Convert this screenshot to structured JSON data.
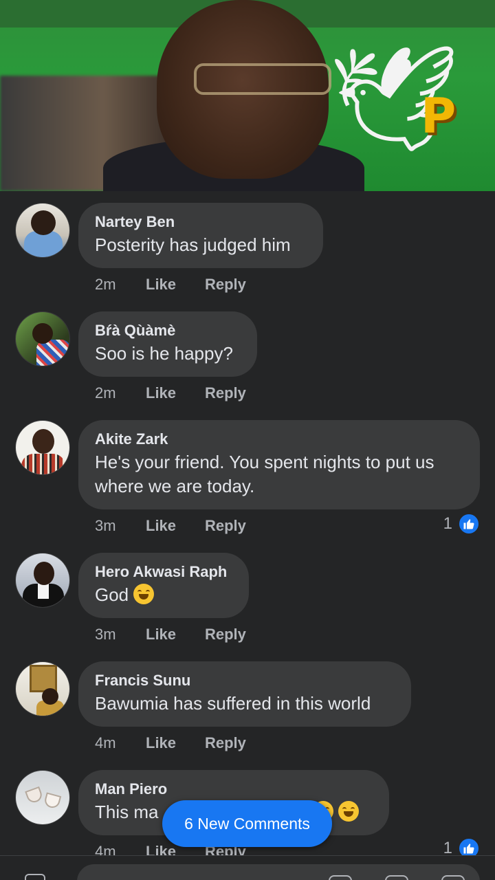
{
  "new_comments_label": "6 New Comments",
  "comments": [
    {
      "name": "Nartey Ben",
      "text": "Posterity has judged him",
      "time": "2m",
      "like": "Like",
      "reply": "Reply"
    },
    {
      "name": "Bŕà Qùàmè",
      "text": "Soo is he happy?",
      "time": "2m",
      "like": "Like",
      "reply": "Reply"
    },
    {
      "name": "Akite Zark",
      "text": "He's your friend. You spent nights to put us where we are today.",
      "time": "3m",
      "like": "Like",
      "reply": "Reply",
      "reactions": "1"
    },
    {
      "name": "Hero Akwasi Raph",
      "text": "God",
      "time": "3m",
      "like": "Like",
      "reply": "Reply"
    },
    {
      "name": "Francis Sunu",
      "text": "Bawumia has suffered in this world",
      "time": "4m",
      "like": "Like",
      "reply": "Reply"
    },
    {
      "name": "Man Piero",
      "text": "This ma",
      "time": "4m",
      "like": "Like",
      "reply": "Reply",
      "reactions": "1"
    }
  ],
  "icons": {
    "like_reaction": "thumbs-up-icon",
    "laugh_emoji": "laughing-emoji-icon",
    "camera": "camera-icon"
  },
  "colors": {
    "background": "#242526",
    "bubble": "#3a3b3c",
    "accent": "#1877f2",
    "meta_text": "#b0b3b8"
  }
}
